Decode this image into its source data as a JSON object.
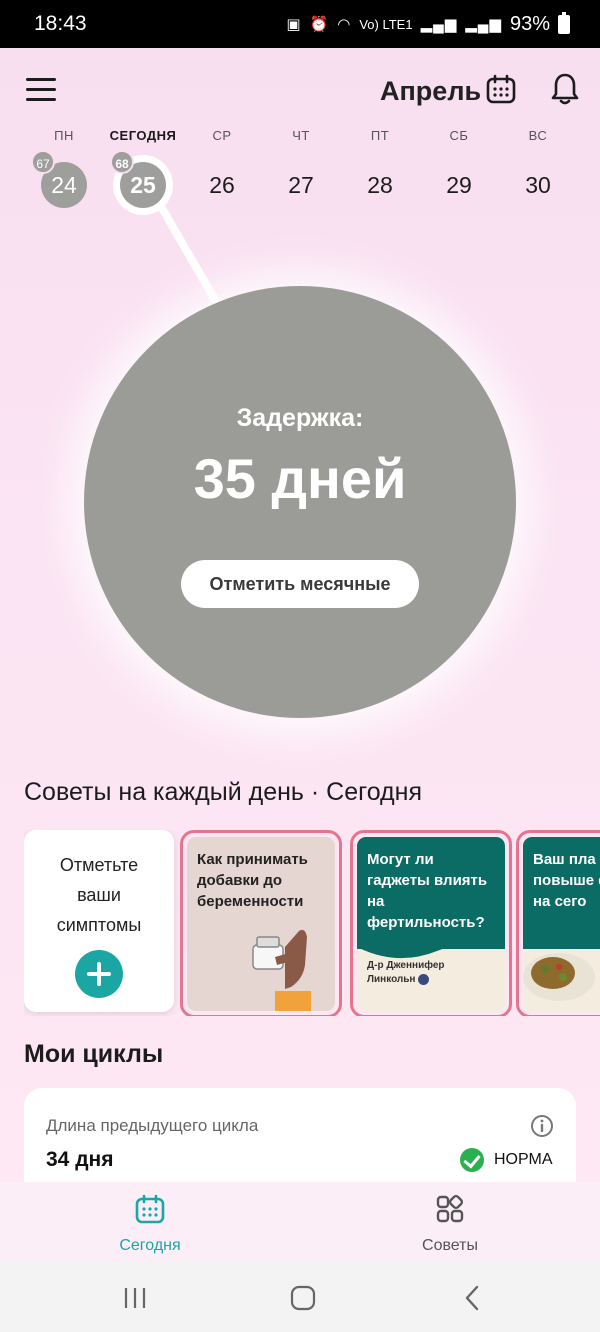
{
  "status_bar": {
    "time": "18:43",
    "network_label": "Vo) LTE1",
    "battery_pct": "93%"
  },
  "header": {
    "month": "Апрель"
  },
  "week": [
    {
      "name": "ПН",
      "num": "24",
      "badge": "67",
      "state": "past"
    },
    {
      "name": "СЕГОДНЯ",
      "num": "25",
      "badge": "68",
      "state": "today"
    },
    {
      "name": "СР",
      "num": "26",
      "badge": "",
      "state": "future"
    },
    {
      "name": "ЧТ",
      "num": "27",
      "badge": "",
      "state": "future"
    },
    {
      "name": "ПТ",
      "num": "28",
      "badge": "",
      "state": "future"
    },
    {
      "name": "СБ",
      "num": "29",
      "badge": "",
      "state": "future"
    },
    {
      "name": "ВС",
      "num": "30",
      "badge": "",
      "state": "future"
    }
  ],
  "status_circle": {
    "label": "Задержка:",
    "value": "35 дней",
    "button": "Отметить месячные"
  },
  "tips": {
    "title": "Советы на каждый день · Сегодня",
    "symptom_card": {
      "line1": "Отметьте",
      "line2": "ваши",
      "line3": "симптомы"
    },
    "stories": [
      {
        "text": "Как принимать добавки до беременности",
        "author": ""
      },
      {
        "text": "Могут ли гаджеты влиять на фертильность?",
        "author_line1": "Д-р Дженнифер",
        "author_line2": "Линкольн"
      },
      {
        "text": "Ваш пла питания повыше фертил на сего"
      }
    ]
  },
  "cycles": {
    "title": "Мои циклы",
    "previous_cycle_label": "Длина предыдущего цикла",
    "previous_cycle_value": "34 дня",
    "status": "НОРМА"
  },
  "bottom_nav": {
    "today": "Сегодня",
    "tips": "Советы"
  },
  "colors": {
    "accent_teal": "#1aa8a6",
    "circle_gray": "#9b9b97",
    "story_border": "#e5758f",
    "ok_green": "#2bb04f"
  }
}
